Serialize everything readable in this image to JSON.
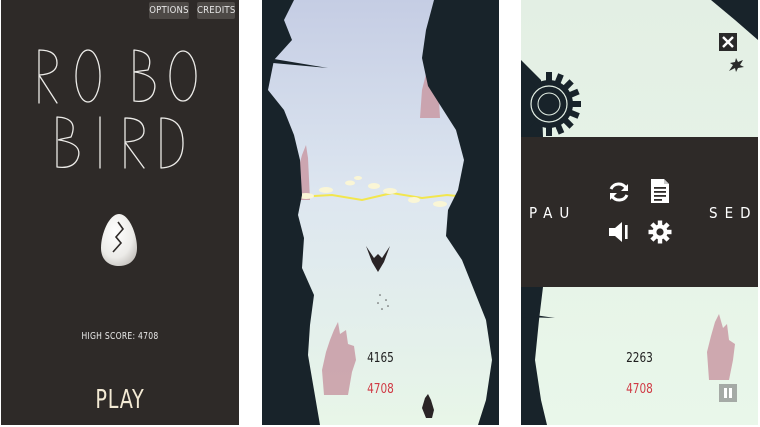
{
  "menu": {
    "options_label": "OPTIONS",
    "credits_label": "CREDITS",
    "title_line1": "ROBO",
    "title_line2": "BIRD",
    "high_score": "HIGH SCORE: 4708",
    "play_label": "PLAY"
  },
  "game": {
    "score": "4165",
    "best": "4708"
  },
  "pause": {
    "word_left": "PAU",
    "word_right": "SED",
    "score": "2263",
    "best": "4708",
    "icons": [
      "restart-icon",
      "document-icon",
      "sound-icon",
      "settings-icon",
      "close-icon",
      "leaf-icon",
      "pause-icon",
      "gear-decoration-icon"
    ]
  },
  "colors": {
    "menu_bg": "#2e2a28",
    "sky_top": "#c9d1e6",
    "sky_bottom": "#e7f5e9",
    "rock": "#18232a",
    "best_score": "#d03a45",
    "lightning": "#f2e64e"
  }
}
